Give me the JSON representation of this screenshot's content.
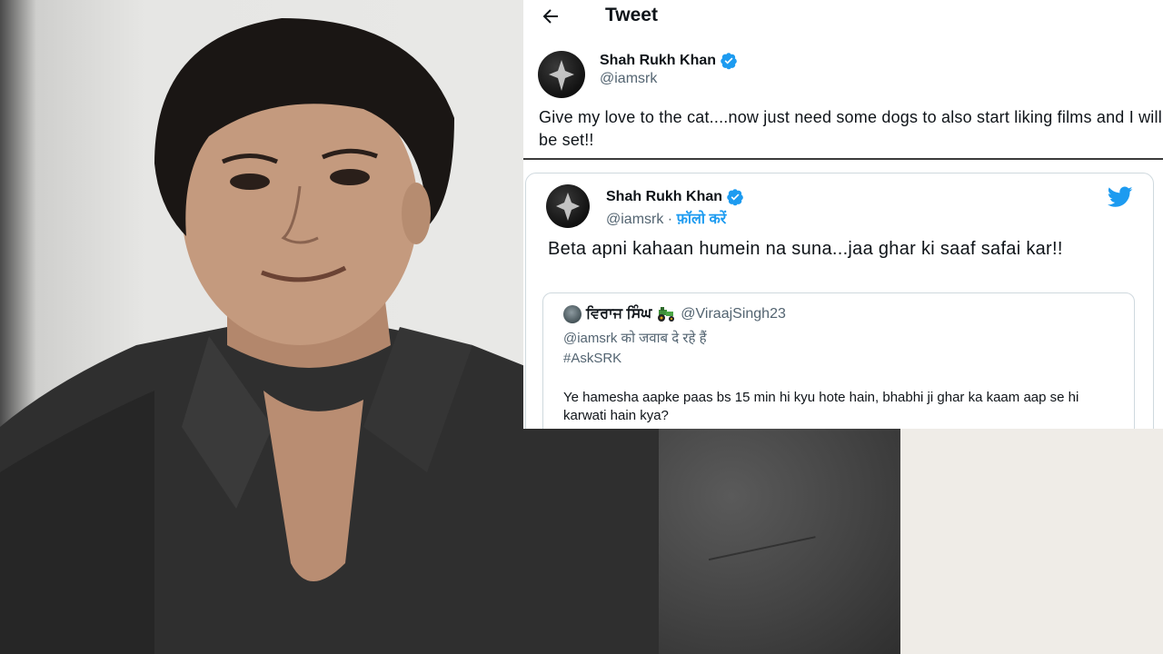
{
  "topbar": {
    "title": "Tweet",
    "back_icon": "arrow-left-icon"
  },
  "author": {
    "name": "Shah Rukh Khan",
    "handle": "@iamsrk",
    "verified_icon": "verified-badge-icon"
  },
  "tweet": {
    "text": "Give my love to the cat....now just need some dogs to also start liking films and I will be set!!"
  },
  "embed": {
    "name": "Shah Rukh Khan",
    "handle": "@iamsrk",
    "separator": " · ",
    "follow_label": "फ़ॉलो करें",
    "platform_icon": "twitter-bird-icon",
    "text": "Beta apni kahaan humein na suna...jaa ghar ki saaf safai kar!!"
  },
  "quote": {
    "name": "ਵਿਰਾਜ ਸਿੰਘ",
    "handle": "@ViraajSingh23",
    "replying": "@iamsrk को जवाब दे रहे हैं",
    "hashtag": "#AskSRK",
    "text": "Ye hamesha aapke paas bs 15 min hi kyu hote hain, bhabhi ji ghar ka kaam aap se hi karwati hain kya?"
  },
  "colors": {
    "accent": "#1d9bf0",
    "text_primary": "#0f1419",
    "text_secondary": "#536471",
    "border": "#cfd9de"
  }
}
